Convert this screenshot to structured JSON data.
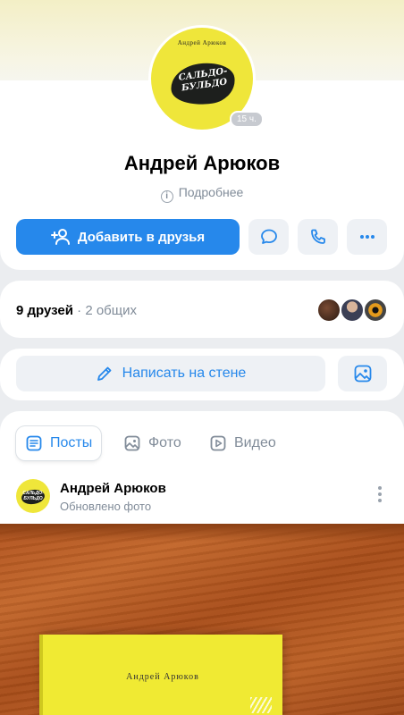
{
  "profile": {
    "name": "Андрей Арюков",
    "details_label": "Подробнее",
    "story_badge": "15 ч.",
    "avatar_top_text": "Андрей Арюков",
    "avatar_title_line1": "САЛЬДО-",
    "avatar_title_line2": "БУЛЬДО"
  },
  "actions": {
    "add_friend_label": "Добавить в друзья",
    "message_icon": "message-icon",
    "call_icon": "phone-icon",
    "more_icon": "more-horizontal-icon"
  },
  "friends": {
    "count_label": "9 друзей",
    "separator": " · ",
    "mutual_label": "2 общих"
  },
  "wall": {
    "write_label": "Написать на стене"
  },
  "tabs": [
    {
      "label": "Посты",
      "icon": "article-icon",
      "active": true
    },
    {
      "label": "Фото",
      "icon": "image-icon",
      "active": false
    },
    {
      "label": "Видео",
      "icon": "video-icon",
      "active": false
    }
  ],
  "post": {
    "author": "Андрей Арюков",
    "subtitle": "Обновлено фото",
    "avatar_text_line1": "САЛЬДО-",
    "avatar_text_line2": "БУЛЬДО",
    "book_author": "Андрей Арюков"
  },
  "colors": {
    "accent": "#2688eb",
    "secondary_text": "#818c99",
    "button_bg": "#eef1f5",
    "avatar_yellow": "#efe63a"
  }
}
